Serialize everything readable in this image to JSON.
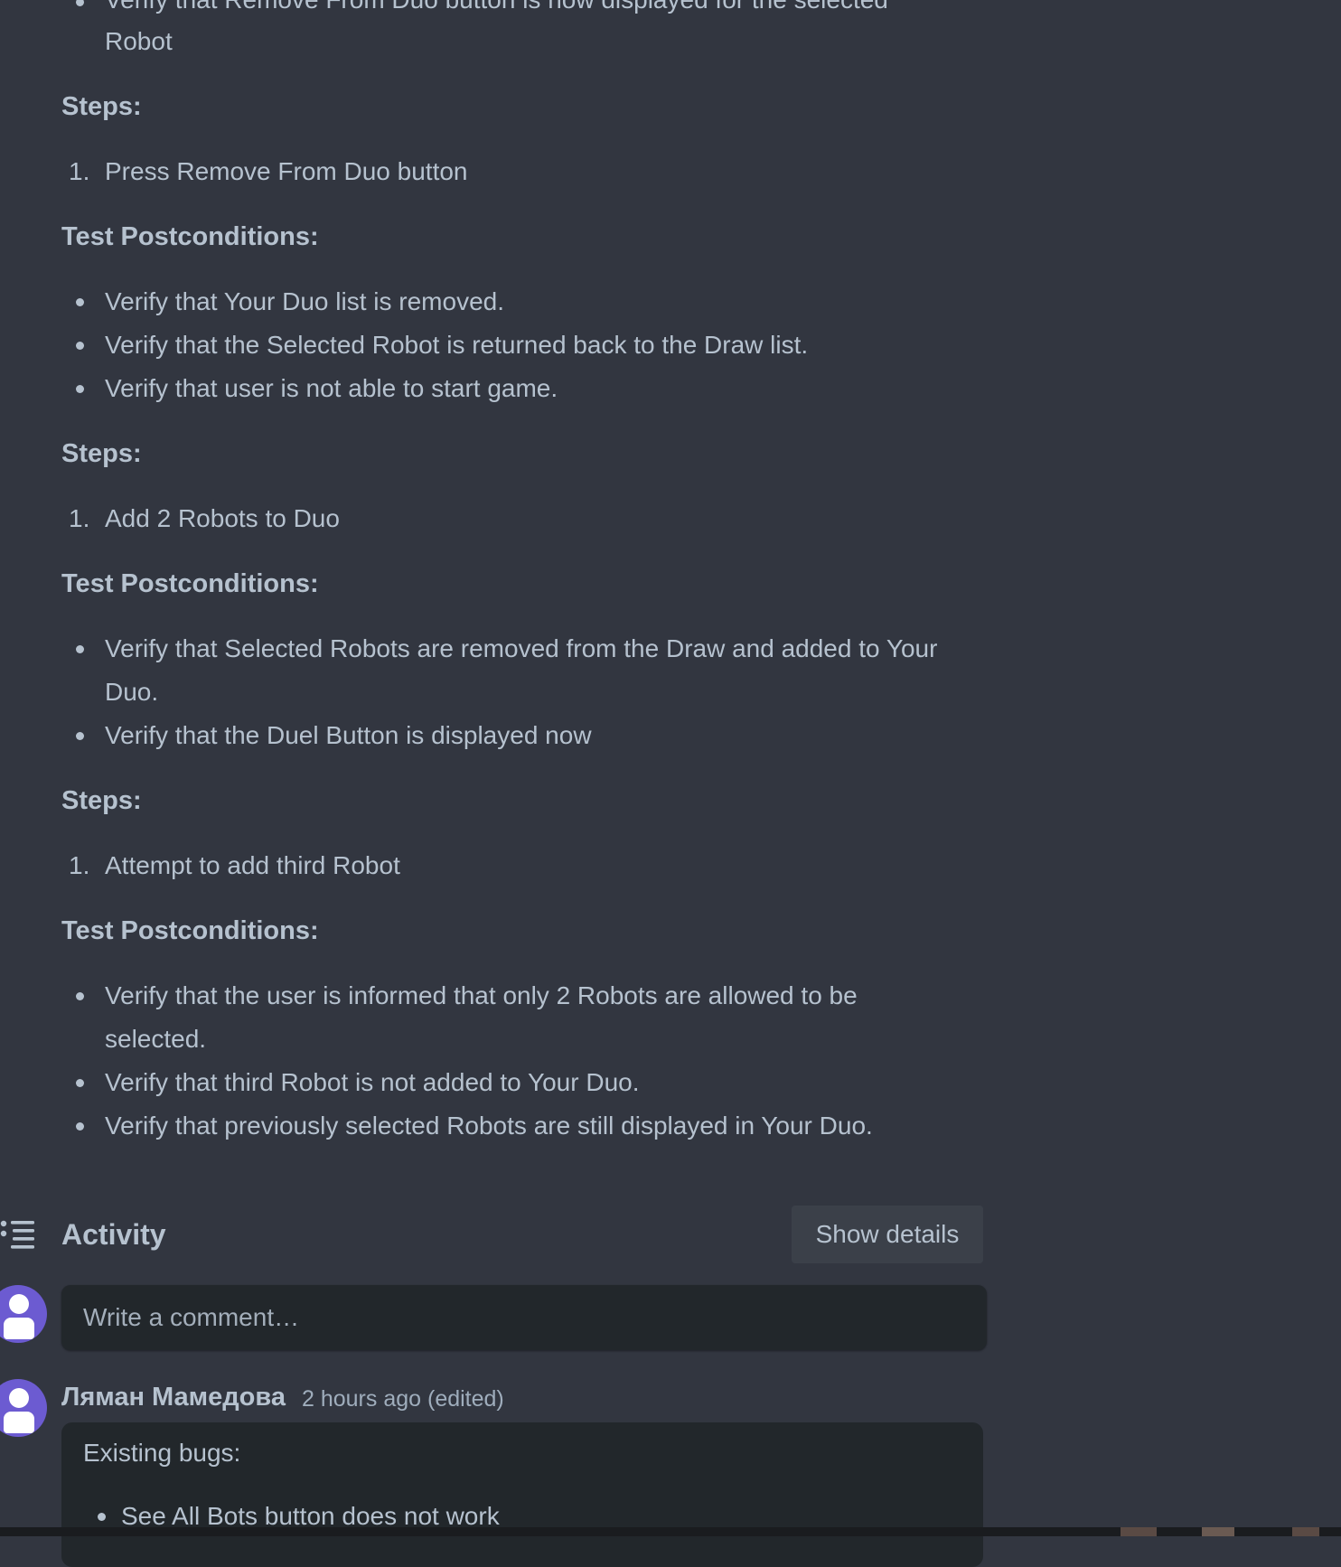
{
  "description": {
    "partial_top_bullet": {
      "line1": "Verify that Remove From Duo button is now displayed for the selected",
      "line2": "Robot"
    },
    "blocks": [
      {
        "steps_heading": "Steps:",
        "steps": [
          {
            "num": "1.",
            "text": "Press Remove From Duo button"
          }
        ],
        "post_heading": "Test Postconditions:",
        "postconditions": [
          [
            "Verify that Your Duo list is removed."
          ],
          [
            "Verify that the Selected Robot is returned back to the Draw list."
          ],
          [
            "Verify that user is not able to start game."
          ]
        ]
      },
      {
        "steps_heading": "Steps:",
        "steps": [
          {
            "num": "1.",
            "text": "Add 2 Robots to Duo"
          }
        ],
        "post_heading": "Test Postconditions:",
        "postconditions": [
          [
            "Verify that Selected Robots are removed from the Draw and added to Your",
            "Duo."
          ],
          [
            "Verify that the Duel Button is displayed now"
          ]
        ]
      },
      {
        "steps_heading": "Steps:",
        "steps": [
          {
            "num": "1.",
            "text": "Attempt to add third Robot"
          }
        ],
        "post_heading": "Test Postconditions:",
        "postconditions": [
          [
            "Verify that the user is informed that only 2 Robots are allowed to be",
            "selected."
          ],
          [
            "Verify that third Robot is not added to Your Duo."
          ],
          [
            "Verify that previously selected Robots are still displayed in Your Duo."
          ]
        ]
      }
    ]
  },
  "activity": {
    "icon": "activity-list-icon",
    "title": "Activity",
    "show_details_label": "Show details",
    "comment_placeholder": "Write a comment…"
  },
  "comments": [
    {
      "author": "Ляман Мамедова",
      "timestamp": "2 hours ago (edited)",
      "heading": "Existing bugs:",
      "bullets": [
        "See All Bots button does not work"
      ]
    }
  ],
  "colors": {
    "background": "#323640",
    "text": "#b6c2cf",
    "input_background": "#22272b",
    "button_background": "#3b4049",
    "avatar": "#6c5bd1"
  }
}
